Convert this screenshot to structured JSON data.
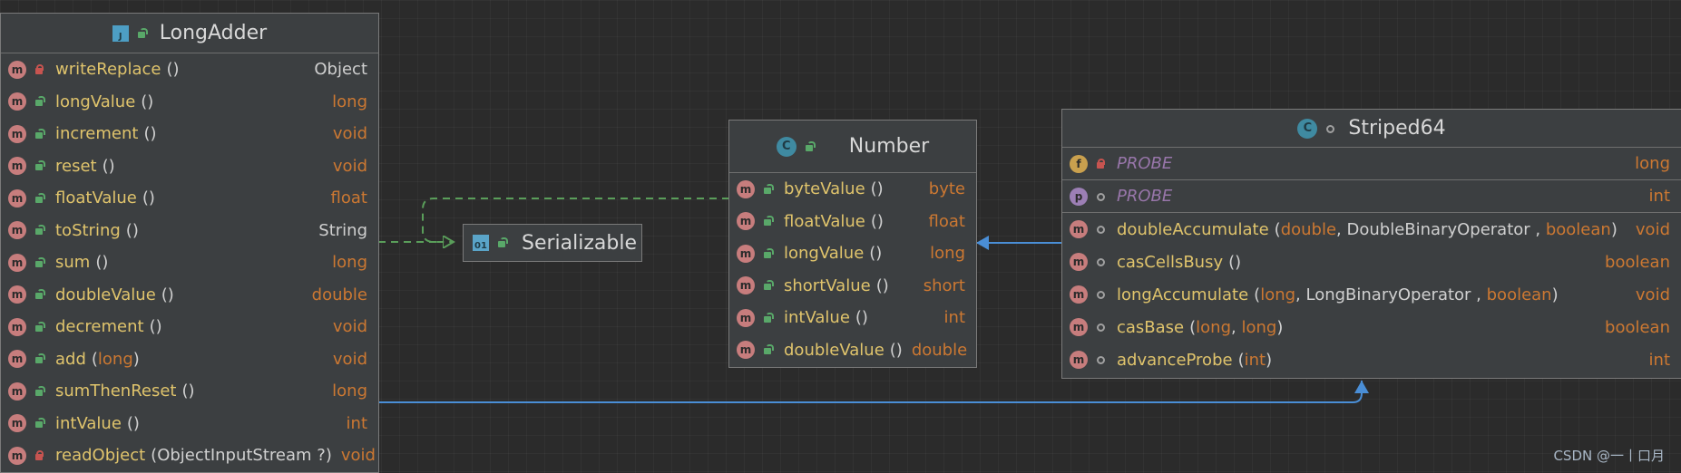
{
  "colors": {
    "background": "#2b2b2b",
    "method_badge": "#c77d7d",
    "field_badge": "#c9a04e",
    "property_badge": "#9c7fb5",
    "public": "#59a869",
    "private": "#c75450",
    "realization_edge": "#5a9e5a",
    "generalization_edge": "#4a8ed6"
  },
  "long_adder": {
    "title": "LongAdder",
    "members": [
      {
        "badge": "m",
        "vis": "private",
        "name": "writeReplace",
        "params": "()",
        "ret": "Object",
        "ret_class": true
      },
      {
        "badge": "m",
        "vis": "public",
        "name": "longValue",
        "params": "()",
        "ret": "long"
      },
      {
        "badge": "m",
        "vis": "public",
        "name": "increment",
        "params": "()",
        "ret": "void"
      },
      {
        "badge": "m",
        "vis": "public",
        "name": "reset",
        "params": "()",
        "ret": "void"
      },
      {
        "badge": "m",
        "vis": "public",
        "name": "floatValue",
        "params": "()",
        "ret": "float"
      },
      {
        "badge": "m",
        "vis": "public",
        "name": "toString",
        "params": "()",
        "ret": "String",
        "ret_class": true
      },
      {
        "badge": "m",
        "vis": "public",
        "name": "sum",
        "params": "()",
        "ret": "long"
      },
      {
        "badge": "m",
        "vis": "public",
        "name": "doubleValue",
        "params": "()",
        "ret": "double"
      },
      {
        "badge": "m",
        "vis": "public",
        "name": "decrement",
        "params": "()",
        "ret": "void"
      },
      {
        "badge": "m",
        "vis": "public",
        "name": "add",
        "params": "(long)",
        "ret": "void"
      },
      {
        "badge": "m",
        "vis": "public",
        "name": "sumThenReset",
        "params": "()",
        "ret": "long"
      },
      {
        "badge": "m",
        "vis": "public",
        "name": "intValue",
        "params": "()",
        "ret": "int"
      },
      {
        "badge": "m",
        "vis": "private",
        "name": "readObject",
        "params": "(ObjectInputStream ?)",
        "ret": "void"
      }
    ]
  },
  "serializable": {
    "title": "Serializable"
  },
  "number": {
    "title": "Number",
    "members": [
      {
        "badge": "m",
        "vis": "public",
        "name": "byteValue",
        "params": "()",
        "ret": "byte"
      },
      {
        "badge": "m",
        "vis": "public",
        "name": "floatValue",
        "params": "()",
        "ret": "float"
      },
      {
        "badge": "m",
        "vis": "public",
        "name": "longValue",
        "params": "()",
        "ret": "long"
      },
      {
        "badge": "m",
        "vis": "public",
        "name": "shortValue",
        "params": "()",
        "ret": "short"
      },
      {
        "badge": "m",
        "vis": "public",
        "name": "intValue",
        "params": "()",
        "ret": "int"
      },
      {
        "badge": "m",
        "vis": "public",
        "name": "doubleValue",
        "params": "()",
        "ret": "double"
      }
    ]
  },
  "striped64": {
    "title": "Striped64",
    "members": [
      {
        "badge": "f",
        "vis": "private",
        "name": "PROBE",
        "field": true,
        "ret": "long",
        "sep": true
      },
      {
        "badge": "p",
        "vis": "pkg",
        "name": "PROBE",
        "field": true,
        "ret": "int",
        "sep": true
      },
      {
        "badge": "m",
        "vis": "pkg",
        "name": "doubleAccumulate",
        "params": "(double, DoubleBinaryOperator , boolean)",
        "ret": "void"
      },
      {
        "badge": "m",
        "vis": "pkg",
        "name": "casCellsBusy",
        "params": "()",
        "ret": "boolean"
      },
      {
        "badge": "m",
        "vis": "pkg",
        "name": "longAccumulate",
        "params": "(long, LongBinaryOperator , boolean)",
        "ret": "void"
      },
      {
        "badge": "m",
        "vis": "pkg",
        "name": "casBase",
        "params": "(long, long)",
        "ret": "boolean"
      },
      {
        "badge": "m",
        "vis": "pkg",
        "name": "advanceProbe",
        "params": "(int)",
        "ret": "int"
      }
    ]
  },
  "watermark": "CSDN @一丨口月"
}
